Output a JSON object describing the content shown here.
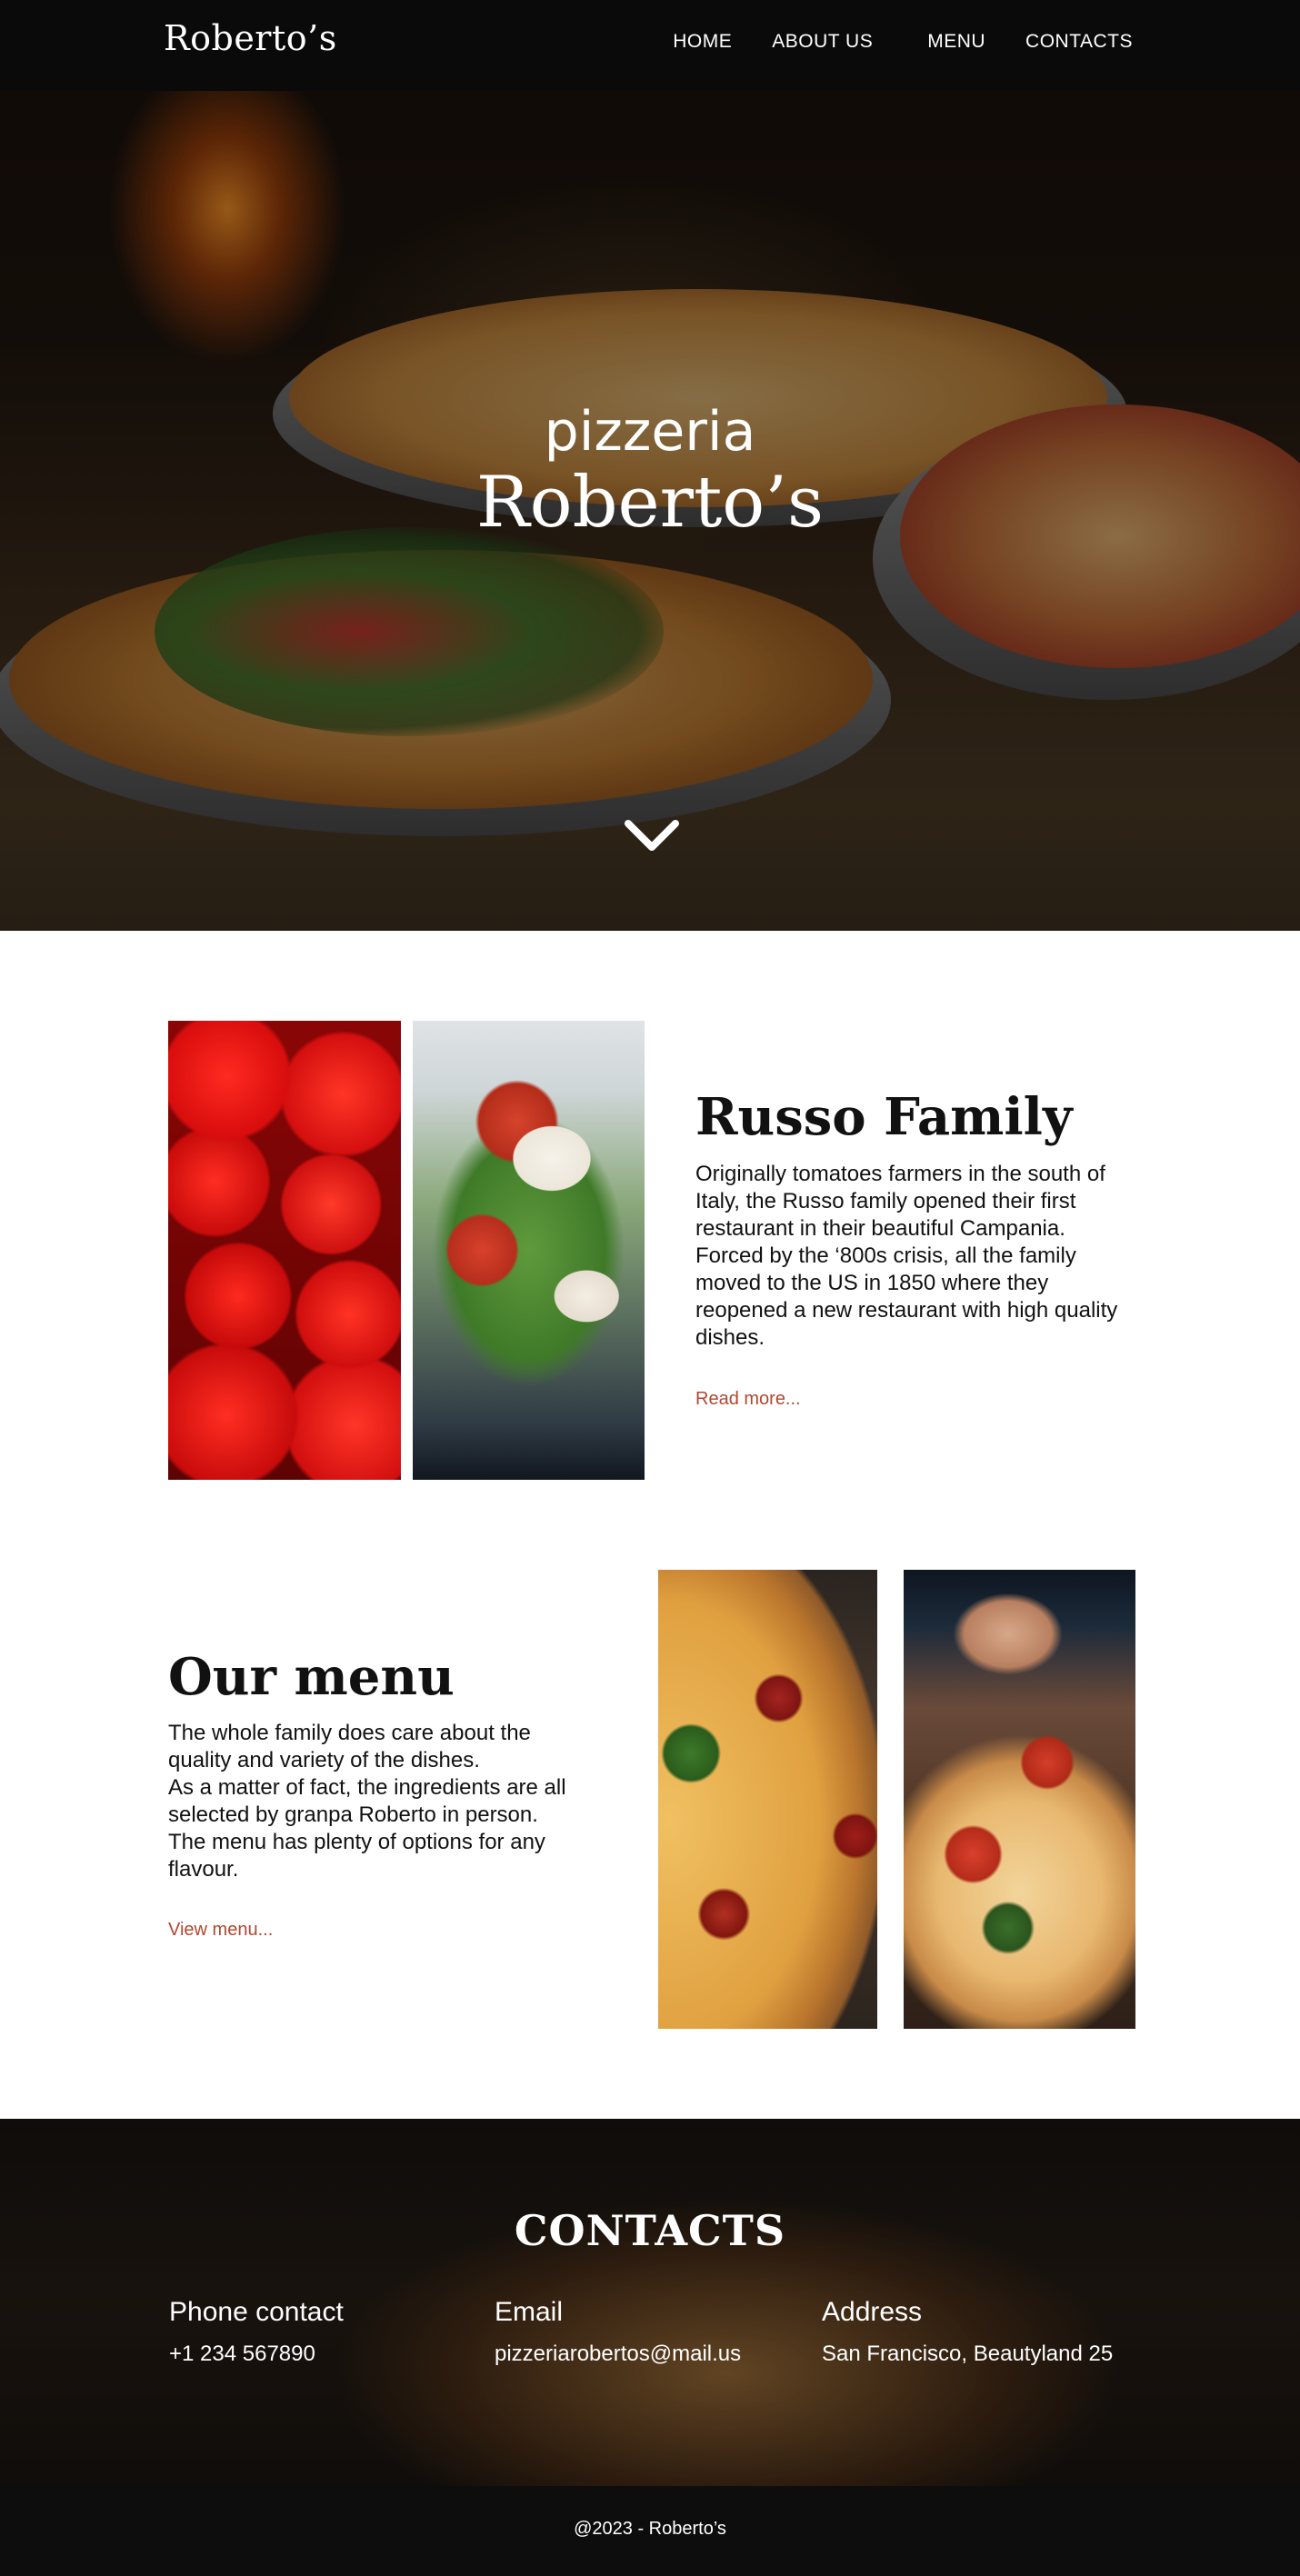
{
  "nav": {
    "brand": "Roberto’s",
    "links": [
      "HOME",
      "ABOUT US",
      "MENU",
      "CONTACTS"
    ]
  },
  "hero": {
    "subtitle": "pizzeria",
    "title": "Roberto’s",
    "scroll_icon": "chevron-down-icon"
  },
  "about": {
    "title": "Russo Family",
    "paragraphs": [
      "Originally tomatoes farmers in the south of Italy, the Russo family opened their first restaurant in their beautiful Campania.",
      "Forced by the ‘800s crisis, all the family moved to the US in 1850 where they reopened a new restaurant with high quality dishes."
    ],
    "link": "Read more..."
  },
  "menu": {
    "title": "Our menu",
    "paragraphs": [
      "The whole family does care about the quality and variety of the dishes.",
      "As a matter of fact, the ingredients are all selected by granpa Roberto in person.",
      "The menu has plenty of options for any flavour."
    ],
    "link": "View menu..."
  },
  "contacts": {
    "title": "CONTACTS",
    "phone_label": "Phone contact",
    "phone": "+1 234 567890",
    "email_label": "Email",
    "email": "pizzeriarobertos@mail.us",
    "address_label": "Address",
    "address": "San Francisco, Beautyland 25"
  },
  "footer": {
    "copyright": "@2023 - Roberto’s"
  },
  "colors": {
    "accent_link": "#b2472e",
    "nav_bg": "#0a0a0a",
    "footer_bg": "#0d0d0d"
  }
}
